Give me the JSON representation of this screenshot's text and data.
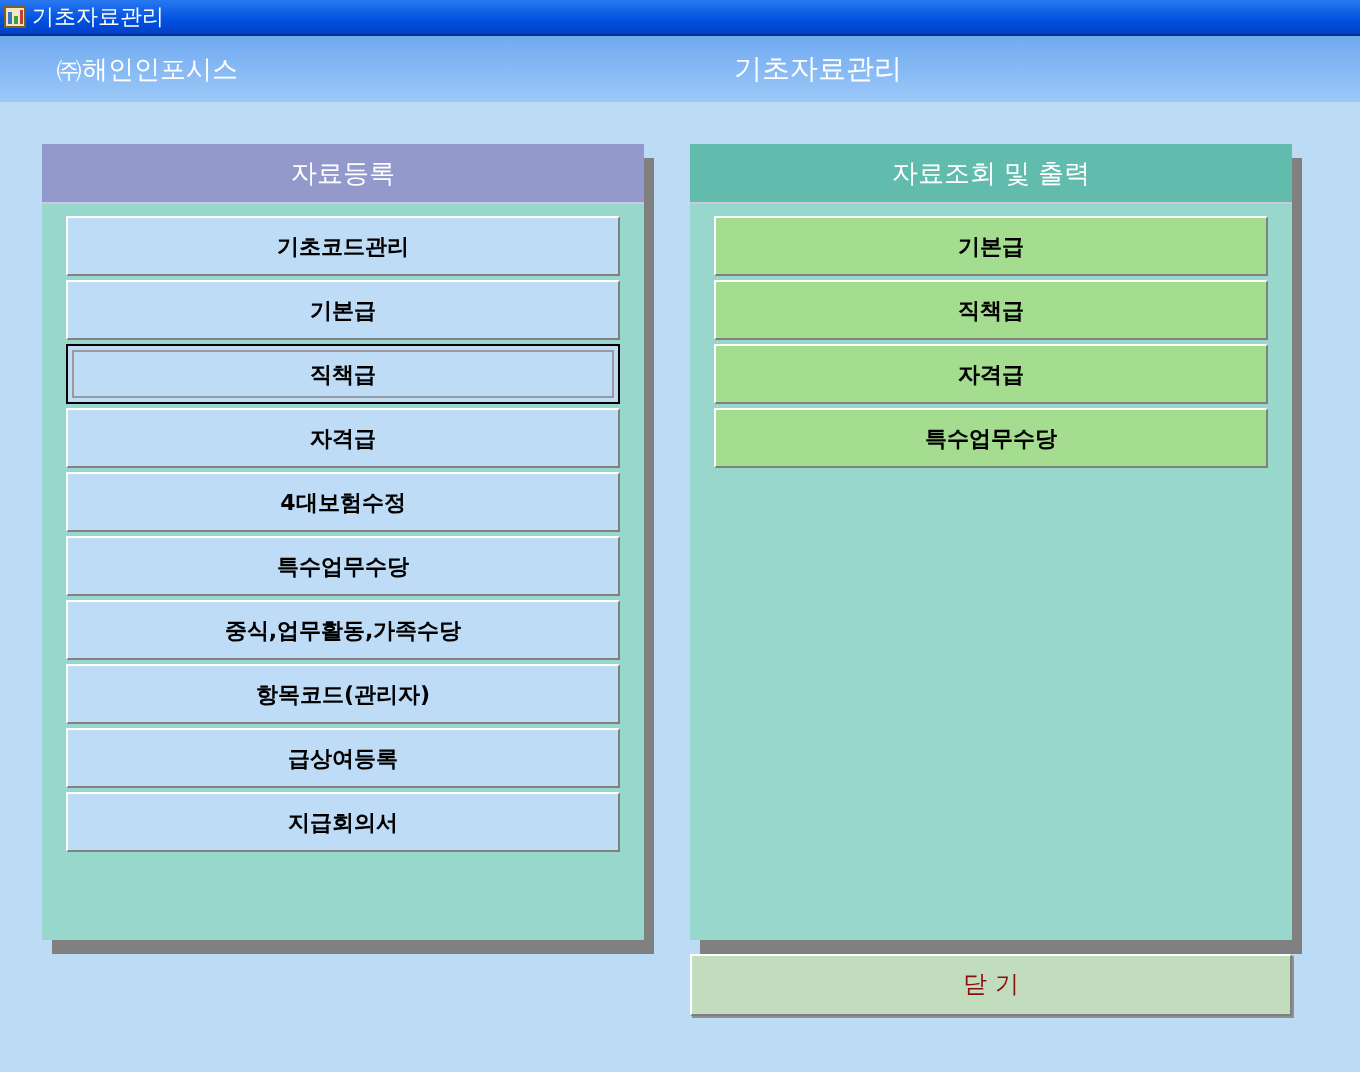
{
  "window": {
    "title": "기초자료관리"
  },
  "header": {
    "company": "㈜해인인포시스",
    "title": "기초자료관리"
  },
  "panels": [
    {
      "title": "자료등록",
      "kind": "register",
      "items": [
        {
          "label": "기초코드관리",
          "selected": false
        },
        {
          "label": "기본급",
          "selected": false
        },
        {
          "label": "직책급",
          "selected": true
        },
        {
          "label": "자격급",
          "selected": false
        },
        {
          "label": "4대보험수정",
          "selected": false
        },
        {
          "label": "특수업무수당",
          "selected": false
        },
        {
          "label": "중식,업무활동,가족수당",
          "selected": false
        },
        {
          "label": "항목코드(관리자)",
          "selected": false
        },
        {
          "label": "급상여등록",
          "selected": false
        },
        {
          "label": "지급회의서",
          "selected": false
        }
      ]
    },
    {
      "title": "자료조회 및 출력",
      "kind": "report",
      "items": [
        {
          "label": "기본급",
          "selected": false
        },
        {
          "label": "직책급",
          "selected": false
        },
        {
          "label": "자격급",
          "selected": false
        },
        {
          "label": "특수업무수당",
          "selected": false
        }
      ]
    }
  ],
  "close_button": "닫 기"
}
